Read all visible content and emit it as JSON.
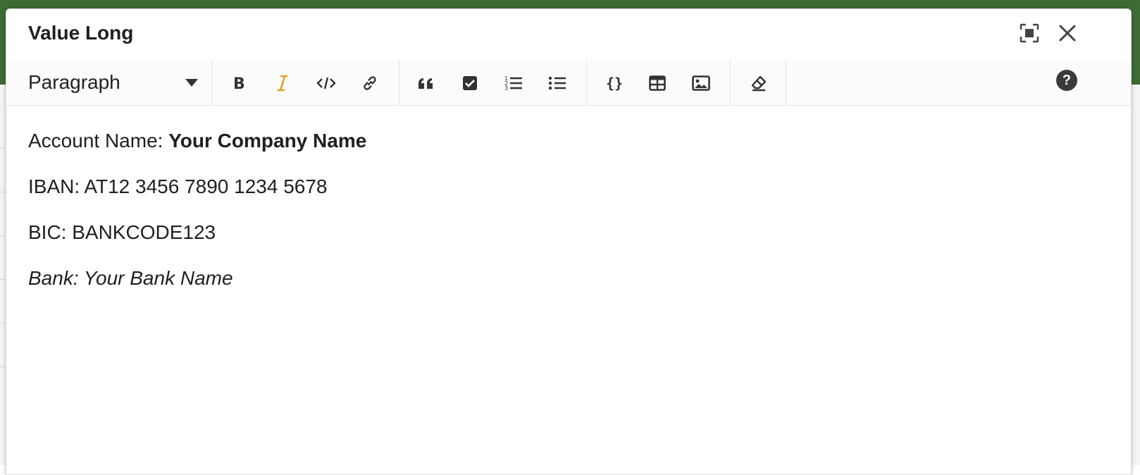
{
  "dialog": {
    "title": "Value Long"
  },
  "toolbar": {
    "block_type": "Paragraph",
    "buttons": [
      {
        "name": "bold-icon"
      },
      {
        "name": "italic-icon",
        "active": true,
        "accent": "#e5a024"
      },
      {
        "name": "code-icon"
      },
      {
        "name": "link-icon"
      },
      {
        "name": "quote-icon"
      },
      {
        "name": "checkbox-icon"
      },
      {
        "name": "ordered-list-icon"
      },
      {
        "name": "bullet-list-icon"
      },
      {
        "name": "code-block-icon"
      },
      {
        "name": "table-icon"
      },
      {
        "name": "image-icon"
      },
      {
        "name": "clear-format-icon"
      }
    ],
    "help": "?"
  },
  "content": {
    "line1_label": "Account Name: ",
    "line1_value": "Your Company Name",
    "line2": "IBAN: AT12 3456 7890 1234 5678",
    "line3": "BIC: BANKCODE123",
    "line4": "Bank: Your Bank Name"
  },
  "colors": {
    "app_header": "#3c6b33",
    "active_accent": "#e5a024",
    "text": "#1f1f1f"
  }
}
